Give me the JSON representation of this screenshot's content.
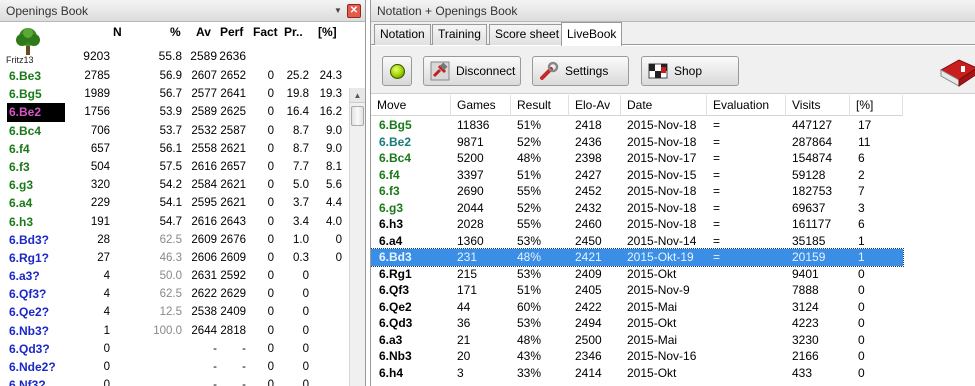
{
  "left": {
    "title": "Openings Book",
    "player": "Fritz13",
    "columns": [
      "N",
      "%",
      "Av",
      "Perf",
      "Fact",
      "Pr..",
      "[%]"
    ],
    "summary": {
      "n": "9203",
      "pct": "55.8",
      "av": "2589",
      "perf": "2636"
    },
    "rows": [
      {
        "move": "6.Be3",
        "color": "green",
        "n": "2785",
        "pct": "56.9",
        "av": "2607",
        "perf": "2652",
        "fact": "0",
        "pr": "25.2",
        "pp": "24.3"
      },
      {
        "move": "6.Bg5",
        "color": "green",
        "n": "1989",
        "pct": "56.7",
        "av": "2577",
        "perf": "2641",
        "fact": "0",
        "pr": "19.8",
        "pp": "19.3"
      },
      {
        "move": "6.Be2",
        "color": "selected",
        "n": "1756",
        "pct": "53.9",
        "av": "2589",
        "perf": "2625",
        "fact": "0",
        "pr": "16.4",
        "pp": "16.2"
      },
      {
        "move": "6.Bc4",
        "color": "green",
        "n": "706",
        "pct": "53.7",
        "av": "2532",
        "perf": "2587",
        "fact": "0",
        "pr": "8.7",
        "pp": "9.0"
      },
      {
        "move": "6.f4",
        "color": "green",
        "n": "657",
        "pct": "56.1",
        "av": "2558",
        "perf": "2621",
        "fact": "0",
        "pr": "8.7",
        "pp": "9.0"
      },
      {
        "move": "6.f3",
        "color": "green",
        "n": "504",
        "pct": "57.5",
        "av": "2616",
        "perf": "2657",
        "fact": "0",
        "pr": "7.7",
        "pp": "8.1"
      },
      {
        "move": "6.g3",
        "color": "green",
        "n": "320",
        "pct": "54.2",
        "av": "2584",
        "perf": "2621",
        "fact": "0",
        "pr": "5.0",
        "pp": "5.6"
      },
      {
        "move": "6.a4",
        "color": "green",
        "n": "229",
        "pct": "54.1",
        "av": "2595",
        "perf": "2621",
        "fact": "0",
        "pr": "3.7",
        "pp": "4.4"
      },
      {
        "move": "6.h3",
        "color": "green",
        "n": "191",
        "pct": "54.7",
        "av": "2616",
        "perf": "2643",
        "fact": "0",
        "pr": "3.4",
        "pp": "4.0"
      },
      {
        "move": "6.Bd3?",
        "color": "blue",
        "n": "28",
        "pct": "62.5",
        "pctGray": true,
        "av": "2609",
        "perf": "2676",
        "fact": "0",
        "pr": "1.0",
        "pp": "0"
      },
      {
        "move": "6.Rg1?",
        "color": "blue",
        "n": "27",
        "pct": "46.3",
        "pctGray": true,
        "av": "2606",
        "perf": "2609",
        "fact": "0",
        "pr": "0.3",
        "pp": "0"
      },
      {
        "move": "6.a3?",
        "color": "blue",
        "n": "4",
        "pct": "50.0",
        "pctGray": true,
        "av": "2631",
        "perf": "2592",
        "fact": "0",
        "pr": "0",
        "pp": ""
      },
      {
        "move": "6.Qf3?",
        "color": "blue",
        "n": "4",
        "pct": "62.5",
        "pctGray": true,
        "av": "2622",
        "perf": "2629",
        "fact": "0",
        "pr": "0",
        "pp": ""
      },
      {
        "move": "6.Qe2?",
        "color": "blue",
        "n": "4",
        "pct": "12.5",
        "pctGray": true,
        "av": "2538",
        "perf": "2409",
        "fact": "0",
        "pr": "0",
        "pp": ""
      },
      {
        "move": "6.Nb3?",
        "color": "blue",
        "n": "1",
        "pct": "100.0",
        "pctGray": true,
        "av": "2644",
        "perf": "2818",
        "fact": "0",
        "pr": "0",
        "pp": ""
      },
      {
        "move": "6.Qd3?",
        "color": "blue",
        "n": "0",
        "pct": "",
        "av": "-",
        "perf": "-",
        "fact": "0",
        "pr": "0",
        "pp": ""
      },
      {
        "move": "6.Nde2?",
        "color": "blue",
        "n": "0",
        "pct": "",
        "av": "-",
        "perf": "-",
        "fact": "0",
        "pr": "0",
        "pp": ""
      },
      {
        "move": "6.Nf3?",
        "color": "blue",
        "n": "0",
        "pct": "",
        "av": "-",
        "perf": "-",
        "fact": "0",
        "pr": "0",
        "pp": ""
      }
    ]
  },
  "right": {
    "title": "Notation + Openings Book",
    "tabs": [
      "Notation",
      "Training",
      "Score sheet",
      "LiveBook"
    ],
    "active_tab": "LiveBook",
    "buttons": {
      "disconnect": "Disconnect",
      "settings": "Settings",
      "shop": "Shop"
    },
    "columns": [
      "Move",
      "Games",
      "Result",
      "Elo-Av",
      "Date",
      "Evaluation",
      "Visits",
      "[%]"
    ],
    "rows": [
      {
        "move": "6.Bg5",
        "color": "green",
        "games": "11836",
        "result": "51%",
        "elo": "2418",
        "date": "2015-Nov-18",
        "eval": "=",
        "visits": "447127",
        "pct": "17"
      },
      {
        "move": "6.Be2",
        "color": "teal",
        "games": "9871",
        "result": "52%",
        "elo": "2436",
        "date": "2015-Nov-18",
        "eval": "=",
        "visits": "287864",
        "pct": "11"
      },
      {
        "move": "6.Bc4",
        "color": "green",
        "games": "5200",
        "result": "48%",
        "elo": "2398",
        "date": "2015-Nov-17",
        "eval": "=",
        "visits": "154874",
        "pct": "6"
      },
      {
        "move": "6.f4",
        "color": "green",
        "games": "3397",
        "result": "51%",
        "elo": "2427",
        "date": "2015-Nov-15",
        "eval": "=",
        "visits": "59128",
        "pct": "2"
      },
      {
        "move": "6.f3",
        "color": "green",
        "games": "2690",
        "result": "55%",
        "elo": "2452",
        "date": "2015-Nov-18",
        "eval": "=",
        "visits": "182753",
        "pct": "7"
      },
      {
        "move": "6.g3",
        "color": "green",
        "games": "2044",
        "result": "52%",
        "elo": "2432",
        "date": "2015-Nov-18",
        "eval": "=",
        "visits": "69637",
        "pct": "3"
      },
      {
        "move": "6.h3",
        "color": "black",
        "games": "2028",
        "result": "55%",
        "elo": "2460",
        "date": "2015-Nov-18",
        "eval": "=",
        "visits": "161177",
        "pct": "6"
      },
      {
        "move": "6.a4",
        "color": "black",
        "games": "1360",
        "result": "53%",
        "elo": "2450",
        "date": "2015-Nov-14",
        "eval": "=",
        "visits": "35185",
        "pct": "1"
      },
      {
        "move": "6.Bd3",
        "color": "selected",
        "games": "231",
        "result": "48%",
        "elo": "2421",
        "date": "2015-Okt-19",
        "eval": "=",
        "visits": "20159",
        "pct": "1"
      },
      {
        "move": "6.Rg1",
        "color": "black",
        "games": "215",
        "result": "53%",
        "elo": "2409",
        "date": "2015-Okt",
        "eval": "",
        "visits": "9401",
        "pct": "0"
      },
      {
        "move": "6.Qf3",
        "color": "black",
        "games": "171",
        "result": "51%",
        "elo": "2405",
        "date": "2015-Nov-9",
        "eval": "",
        "visits": "7888",
        "pct": "0"
      },
      {
        "move": "6.Qe2",
        "color": "black",
        "games": "44",
        "result": "60%",
        "elo": "2422",
        "date": "2015-Mai",
        "eval": "",
        "visits": "3124",
        "pct": "0"
      },
      {
        "move": "6.Qd3",
        "color": "black",
        "games": "36",
        "result": "53%",
        "elo": "2494",
        "date": "2015-Okt",
        "eval": "",
        "visits": "4223",
        "pct": "0"
      },
      {
        "move": "6.a3",
        "color": "black",
        "games": "21",
        "result": "48%",
        "elo": "2500",
        "date": "2015-Mai",
        "eval": "",
        "visits": "3230",
        "pct": "0"
      },
      {
        "move": "6.Nb3",
        "color": "black",
        "games": "20",
        "result": "43%",
        "elo": "2346",
        "date": "2015-Nov-16",
        "eval": "",
        "visits": "2166",
        "pct": "0"
      },
      {
        "move": "6.h4",
        "color": "black",
        "games": "3",
        "result": "33%",
        "elo": "2414",
        "date": "2015-Okt",
        "eval": "",
        "visits": "433",
        "pct": "0"
      }
    ]
  },
  "colors": {
    "green": "#1a7a1a",
    "teal": "#1a7a7a",
    "blue": "#1a28c8",
    "selection": "#3a8ee6"
  }
}
